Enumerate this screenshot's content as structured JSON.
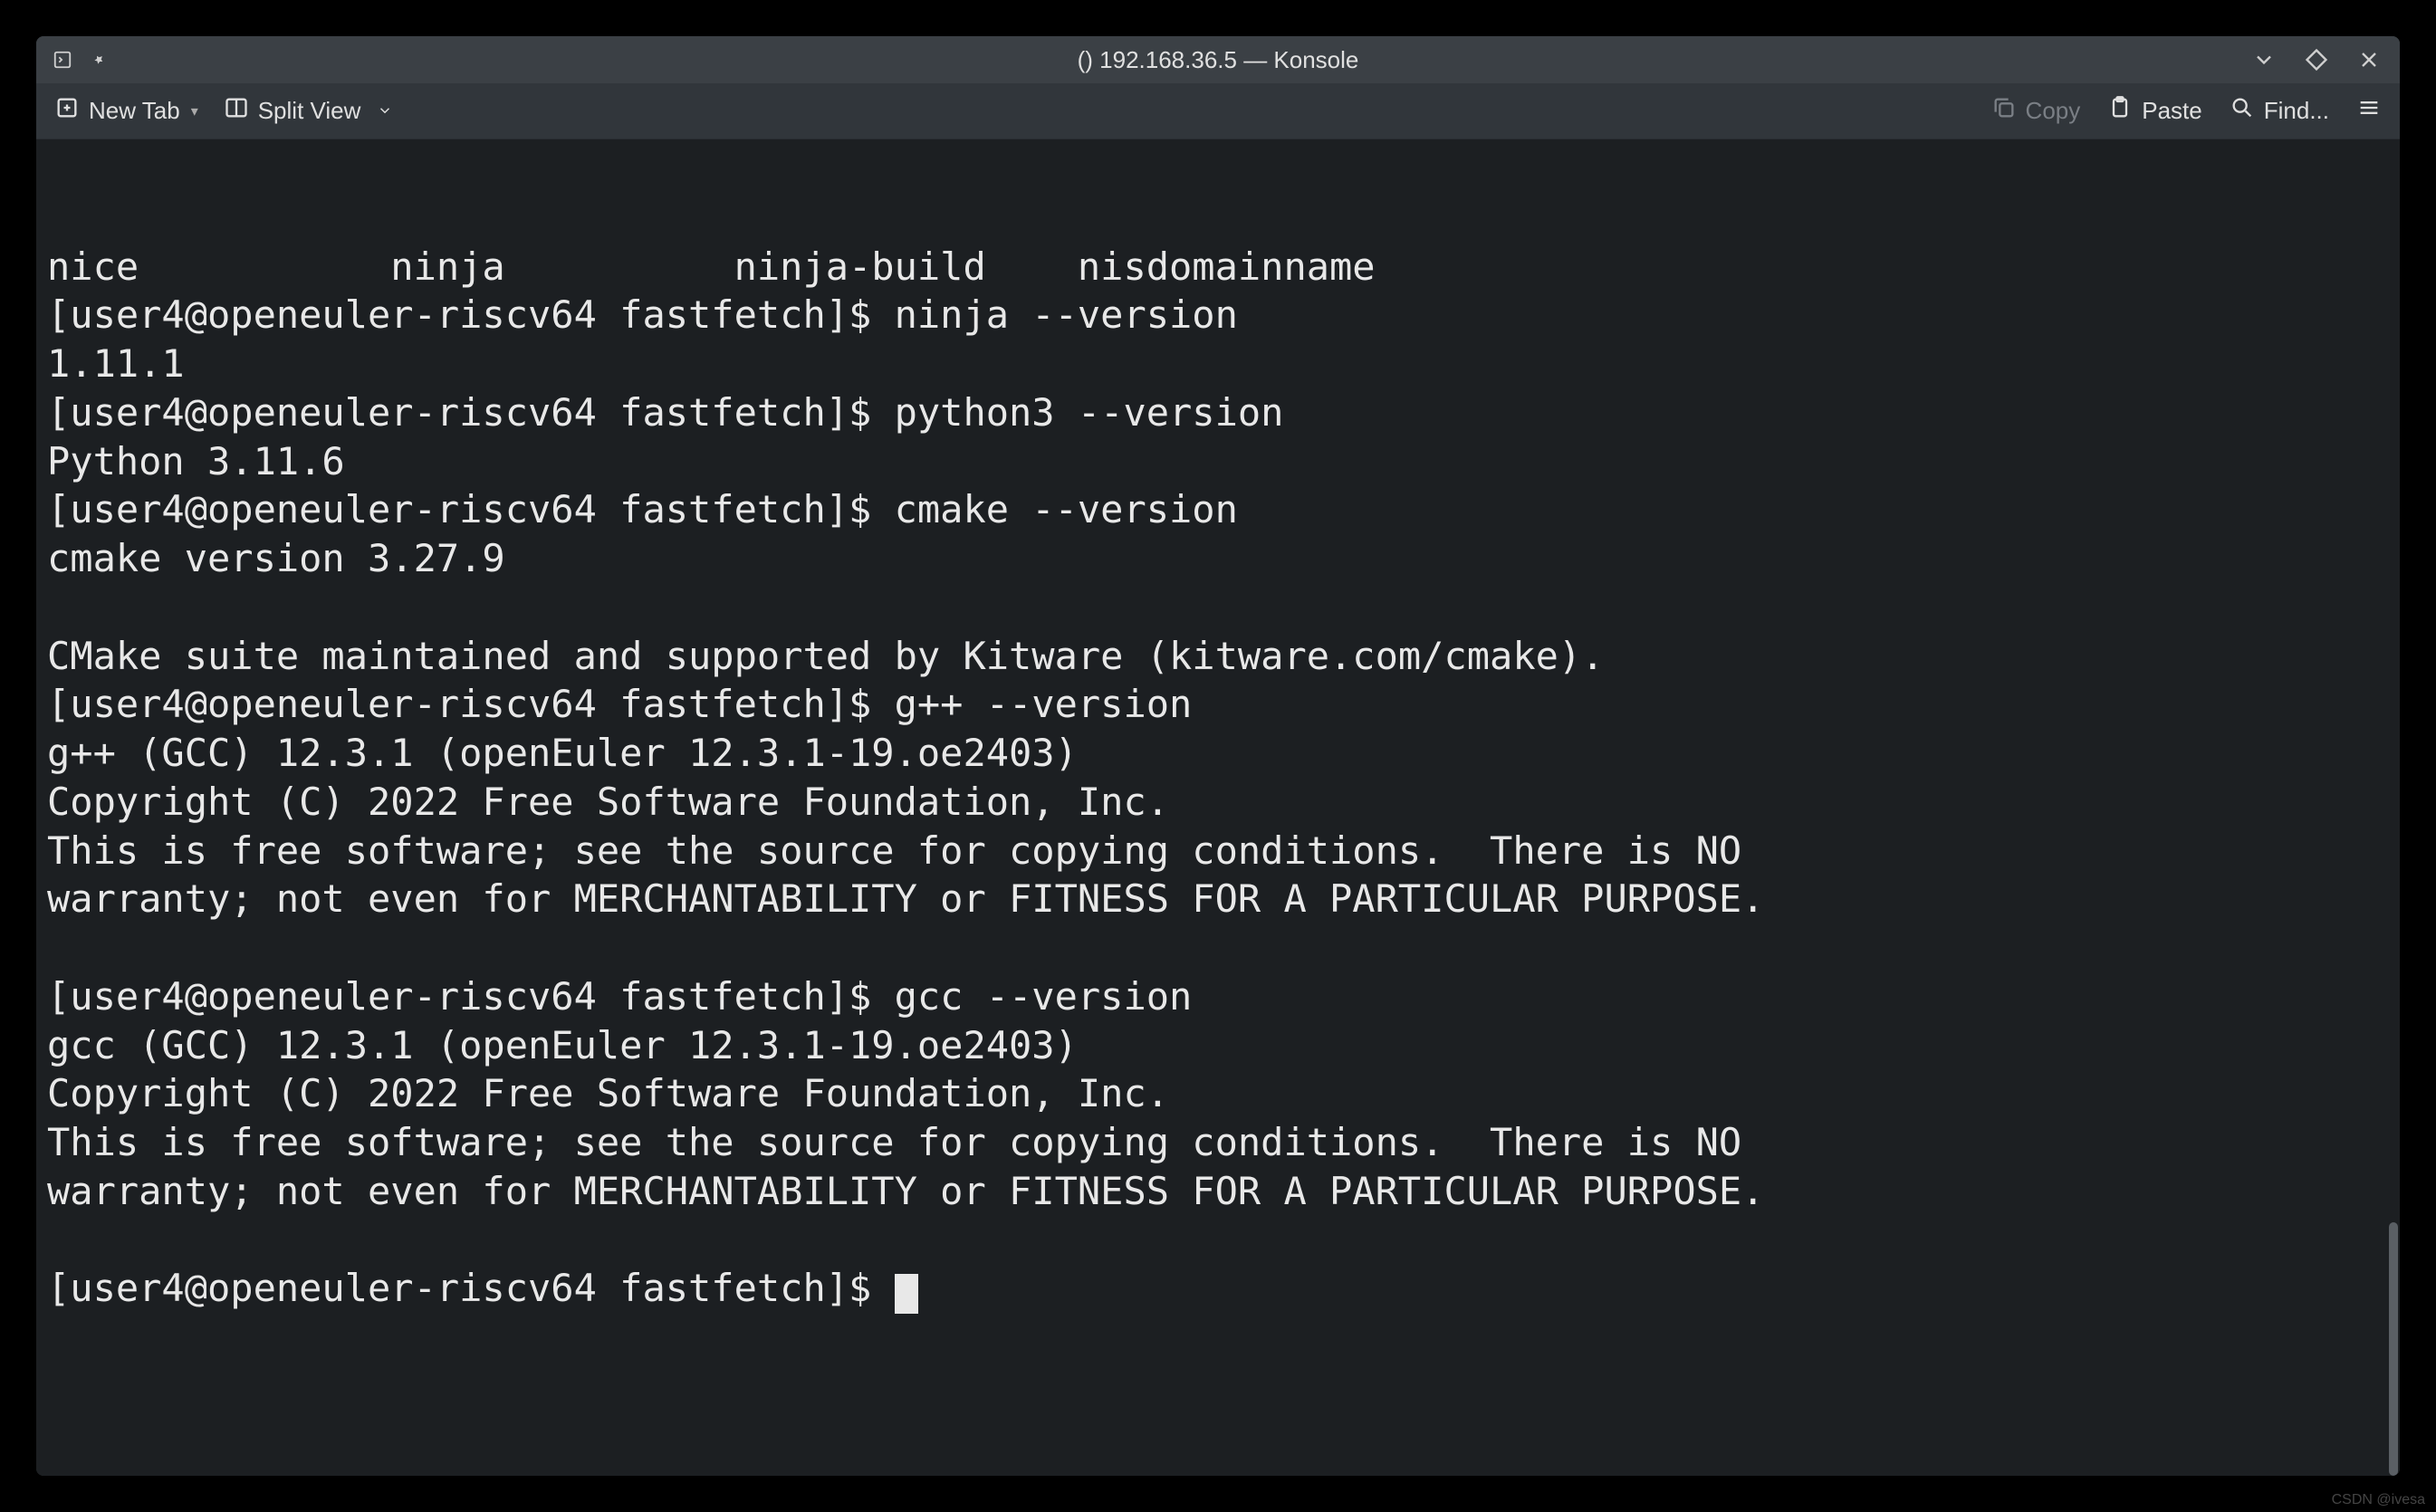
{
  "window": {
    "title": "() 192.168.36.5 — Konsole"
  },
  "toolbar": {
    "new_tab": "New Tab",
    "split_view": "Split View",
    "copy": "Copy",
    "paste": "Paste",
    "find": "Find..."
  },
  "terminal": {
    "lines": [
      "nice           ninja          ninja-build    nisdomainname",
      "[user4@openeuler-riscv64 fastfetch]$ ninja --version",
      "1.11.1",
      "[user4@openeuler-riscv64 fastfetch]$ python3 --version",
      "Python 3.11.6",
      "[user4@openeuler-riscv64 fastfetch]$ cmake --version",
      "cmake version 3.27.9",
      "",
      "CMake suite maintained and supported by Kitware (kitware.com/cmake).",
      "[user4@openeuler-riscv64 fastfetch]$ g++ --version",
      "g++ (GCC) 12.3.1 (openEuler 12.3.1-19.oe2403)",
      "Copyright (C) 2022 Free Software Foundation, Inc.",
      "This is free software; see the source for copying conditions.  There is NO",
      "warranty; not even for MERCHANTABILITY or FITNESS FOR A PARTICULAR PURPOSE.",
      "",
      "[user4@openeuler-riscv64 fastfetch]$ gcc --version",
      "gcc (GCC) 12.3.1 (openEuler 12.3.1-19.oe2403)",
      "Copyright (C) 2022 Free Software Foundation, Inc.",
      "This is free software; see the source for copying conditions.  There is NO",
      "warranty; not even for MERCHANTABILITY or FITNESS FOR A PARTICULAR PURPOSE.",
      "",
      "[user4@openeuler-riscv64 fastfetch]$ "
    ]
  },
  "watermark": "CSDN @ivesa"
}
